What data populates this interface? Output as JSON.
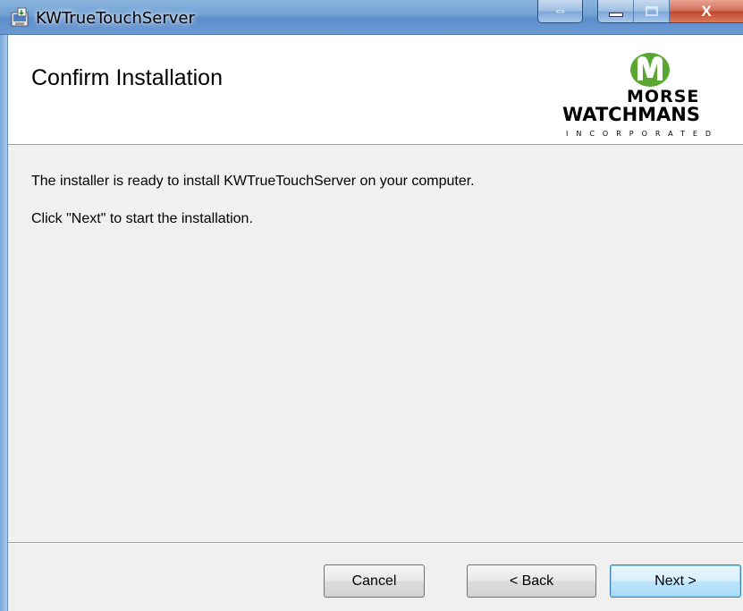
{
  "window": {
    "title": "KWTrueTouchServer",
    "icon": "installer-icon",
    "controls": {
      "swap_glyph": "⇔",
      "close_glyph": "X"
    }
  },
  "banner": {
    "title": "Confirm Installation",
    "logo": {
      "line1": "MORSE",
      "line2": "WATCHMANS",
      "line3": "INCORPORATED"
    }
  },
  "content": {
    "line1": "The installer is ready to install KWTrueTouchServer on your computer.",
    "line2": "Click \"Next\" to start the installation."
  },
  "buttons": {
    "cancel": "Cancel",
    "back": "< Back",
    "next": "Next >"
  },
  "colors": {
    "titlebar": "#6f9fd3",
    "logo_green": "#5aa832",
    "content_bg": "#f0f0f0",
    "next_border": "#3c7fb1"
  }
}
